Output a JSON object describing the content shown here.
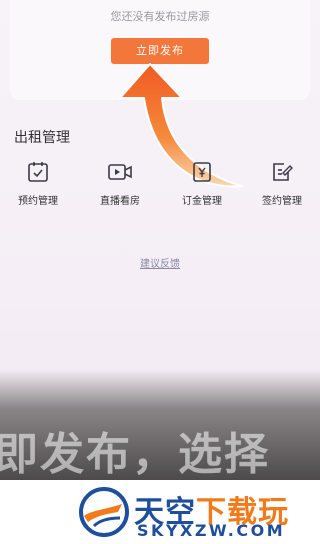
{
  "empty_state": {
    "message": "您还没有发布过房源",
    "publish_button": "立即发布"
  },
  "rental_management": {
    "title": "出租管理",
    "items": [
      {
        "label": "预约管理",
        "icon": "calendar-check-icon"
      },
      {
        "label": "直播看房",
        "icon": "video-camera-icon"
      },
      {
        "label": "订金管理",
        "icon": "deposit-icon"
      },
      {
        "label": "签约管理",
        "icon": "contract-edit-icon"
      }
    ]
  },
  "feedback_link": "建议反馈",
  "video_caption": "即发布，选择",
  "watermark": {
    "brand_cn_part1": "天空",
    "brand_cn_part2": "下载玩",
    "brand_en": "SKYXZW.COM"
  },
  "colors": {
    "accent": "#f3763a",
    "brand_blue": "#1f4f9c",
    "brand_orange": "#f07a1c"
  }
}
